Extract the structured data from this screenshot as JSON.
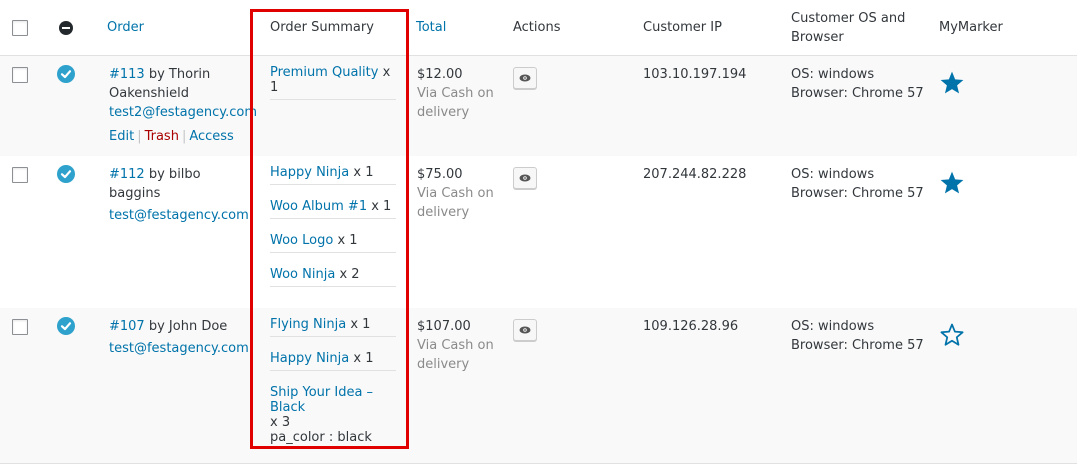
{
  "columns": {
    "order": "Order",
    "summary": "Order Summary",
    "total": "Total",
    "actions": "Actions",
    "ip": "Customer IP",
    "os_line1": "Customer OS and",
    "os_line2": "Browser",
    "marker": "MyMarker"
  },
  "colors": {
    "link": "#0073aa",
    "status_complete": "#2ea2cc",
    "star": "#0073aa",
    "highlight": "#e00000",
    "trash": "#aa0000"
  },
  "orders": [
    {
      "number": "#113",
      "by": "by Thorin",
      "by2": "Oakenshield",
      "email": "test2@festagency.com",
      "row_actions": [
        "Edit",
        "Trash",
        "Access"
      ],
      "items": [
        {
          "name": "Premium Quality",
          "qty": "x 1"
        }
      ],
      "total": "$12.00",
      "payment1": "Via Cash on",
      "payment2": "delivery",
      "ip": "103.10.197.194",
      "os": "OS: windows",
      "browser": "Browser: Chrome 57",
      "marked": true,
      "status_icon": "check-circle-icon"
    },
    {
      "number": "#112",
      "by": "by bilbo baggins",
      "email": "test@festagency.com",
      "items": [
        {
          "name": "Happy Ninja",
          "qty": "x 1"
        },
        {
          "name": "Woo Album #1",
          "qty": "x 1"
        },
        {
          "name": "Woo Logo",
          "qty": "x 1"
        },
        {
          "name": "Woo Ninja",
          "qty": "x 2"
        }
      ],
      "total": "$75.00",
      "payment1": "Via Cash on",
      "payment2": "delivery",
      "ip": "207.244.82.228",
      "os": "OS: windows",
      "browser": "Browser: Chrome 57",
      "marked": true,
      "status_icon": "check-circle-icon"
    },
    {
      "number": "#107",
      "by": "by John Doe",
      "email": "test@festagency.com",
      "items": [
        {
          "name": "Flying Ninja",
          "qty": "x 1"
        },
        {
          "name": "Happy Ninja",
          "qty": "x 1"
        },
        {
          "name": "Ship Your Idea – Black",
          "qty": "x 3",
          "meta": "pa_color : black"
        }
      ],
      "total": "$107.00",
      "payment1": "Via Cash on",
      "payment2": "delivery",
      "ip": "109.126.28.96",
      "os": "OS: windows",
      "browser": "Browser: Chrome 57",
      "marked": false,
      "status_icon": "check-circle-icon"
    }
  ]
}
